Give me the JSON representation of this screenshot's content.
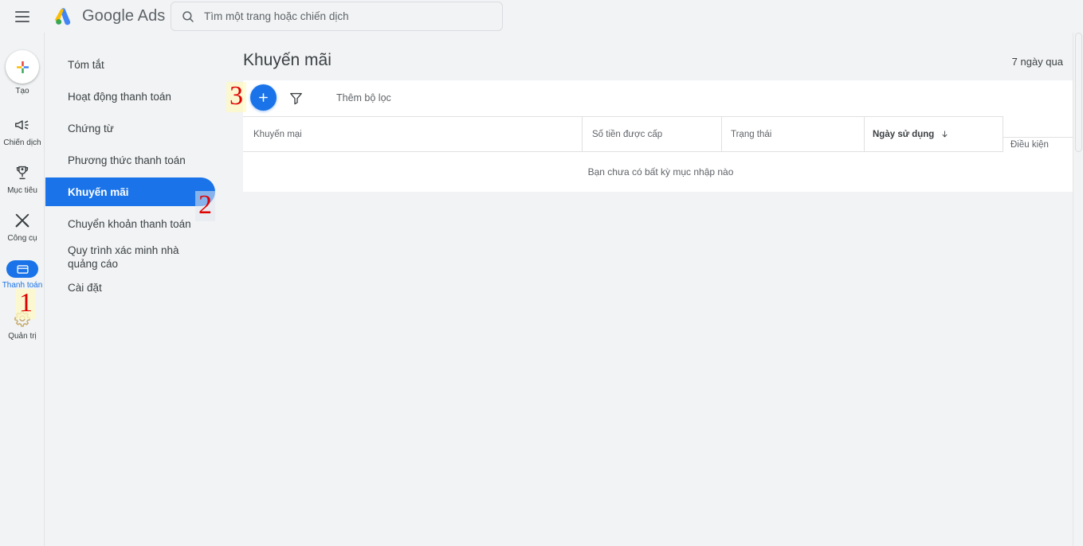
{
  "header": {
    "menu_icon": "hamburger-menu-icon",
    "brand": "Google Ads",
    "brand_google": "Google",
    "brand_ads": "Ads",
    "search": {
      "icon": "search-icon",
      "placeholder": "Tìm một trang hoặc chiến dịch",
      "value": ""
    }
  },
  "rail": {
    "items": [
      {
        "label": "Tạo",
        "icon": "plus-icon",
        "active": false
      },
      {
        "label": "Chiến dịch",
        "icon": "megaphone-icon",
        "active": false
      },
      {
        "label": "Mục tiêu",
        "icon": "trophy-icon",
        "active": false
      },
      {
        "label": "Công cụ",
        "icon": "tools-icon",
        "active": false
      },
      {
        "label": "Thanh toán",
        "icon": "billing-card-icon",
        "active": true
      },
      {
        "label": "Quản trị",
        "icon": "gear-icon",
        "active": false
      }
    ]
  },
  "nav": {
    "items": [
      {
        "label": "Tóm tắt",
        "selected": false
      },
      {
        "label": "Hoạt động thanh toán",
        "selected": false
      },
      {
        "label": "Chứng từ",
        "selected": false
      },
      {
        "label": "Phương thức thanh toán",
        "selected": false
      },
      {
        "label": "Khuyến mãi",
        "selected": true
      },
      {
        "label": "Chuyển khoản thanh toán",
        "selected": false
      },
      {
        "label": "Quy trình xác minh nhà\nquảng cáo",
        "selected": false
      },
      {
        "label": "Cài đặt",
        "selected": false
      }
    ]
  },
  "main": {
    "title": "Khuyến mãi",
    "date_range": "7 ngày qua",
    "toolbar": {
      "add_icon": "plus-icon",
      "filter_icon": "filter-funnel-icon",
      "filter_label": "Thêm bộ lọc"
    },
    "table": {
      "columns": [
        {
          "label": "Khuyến mại",
          "sorted": false
        },
        {
          "label": "Số tiền được cấp",
          "sorted": false
        },
        {
          "label": "Trạng thái",
          "sorted": false
        },
        {
          "label": "Ngày sử dụng",
          "sorted": true,
          "sort_direction": "descending",
          "sort_icon": "arrow-down-icon"
        }
      ],
      "frozen_column": {
        "label": "Điều kiện"
      },
      "rows": [],
      "empty_message": "Bạn chưa có bất kỳ mục nhập nào"
    }
  },
  "annotations": [
    {
      "number": "1",
      "target": "rail-item-quan-tri"
    },
    {
      "number": "2",
      "target": "nav-item-khuyen-mai"
    },
    {
      "number": "3",
      "target": "add-promotion-button"
    }
  ],
  "colors": {
    "accent_blue": "#1a73e8",
    "page_background": "#f1f3f4",
    "card_background": "#ffffff",
    "annotation_red": "#e00000"
  }
}
